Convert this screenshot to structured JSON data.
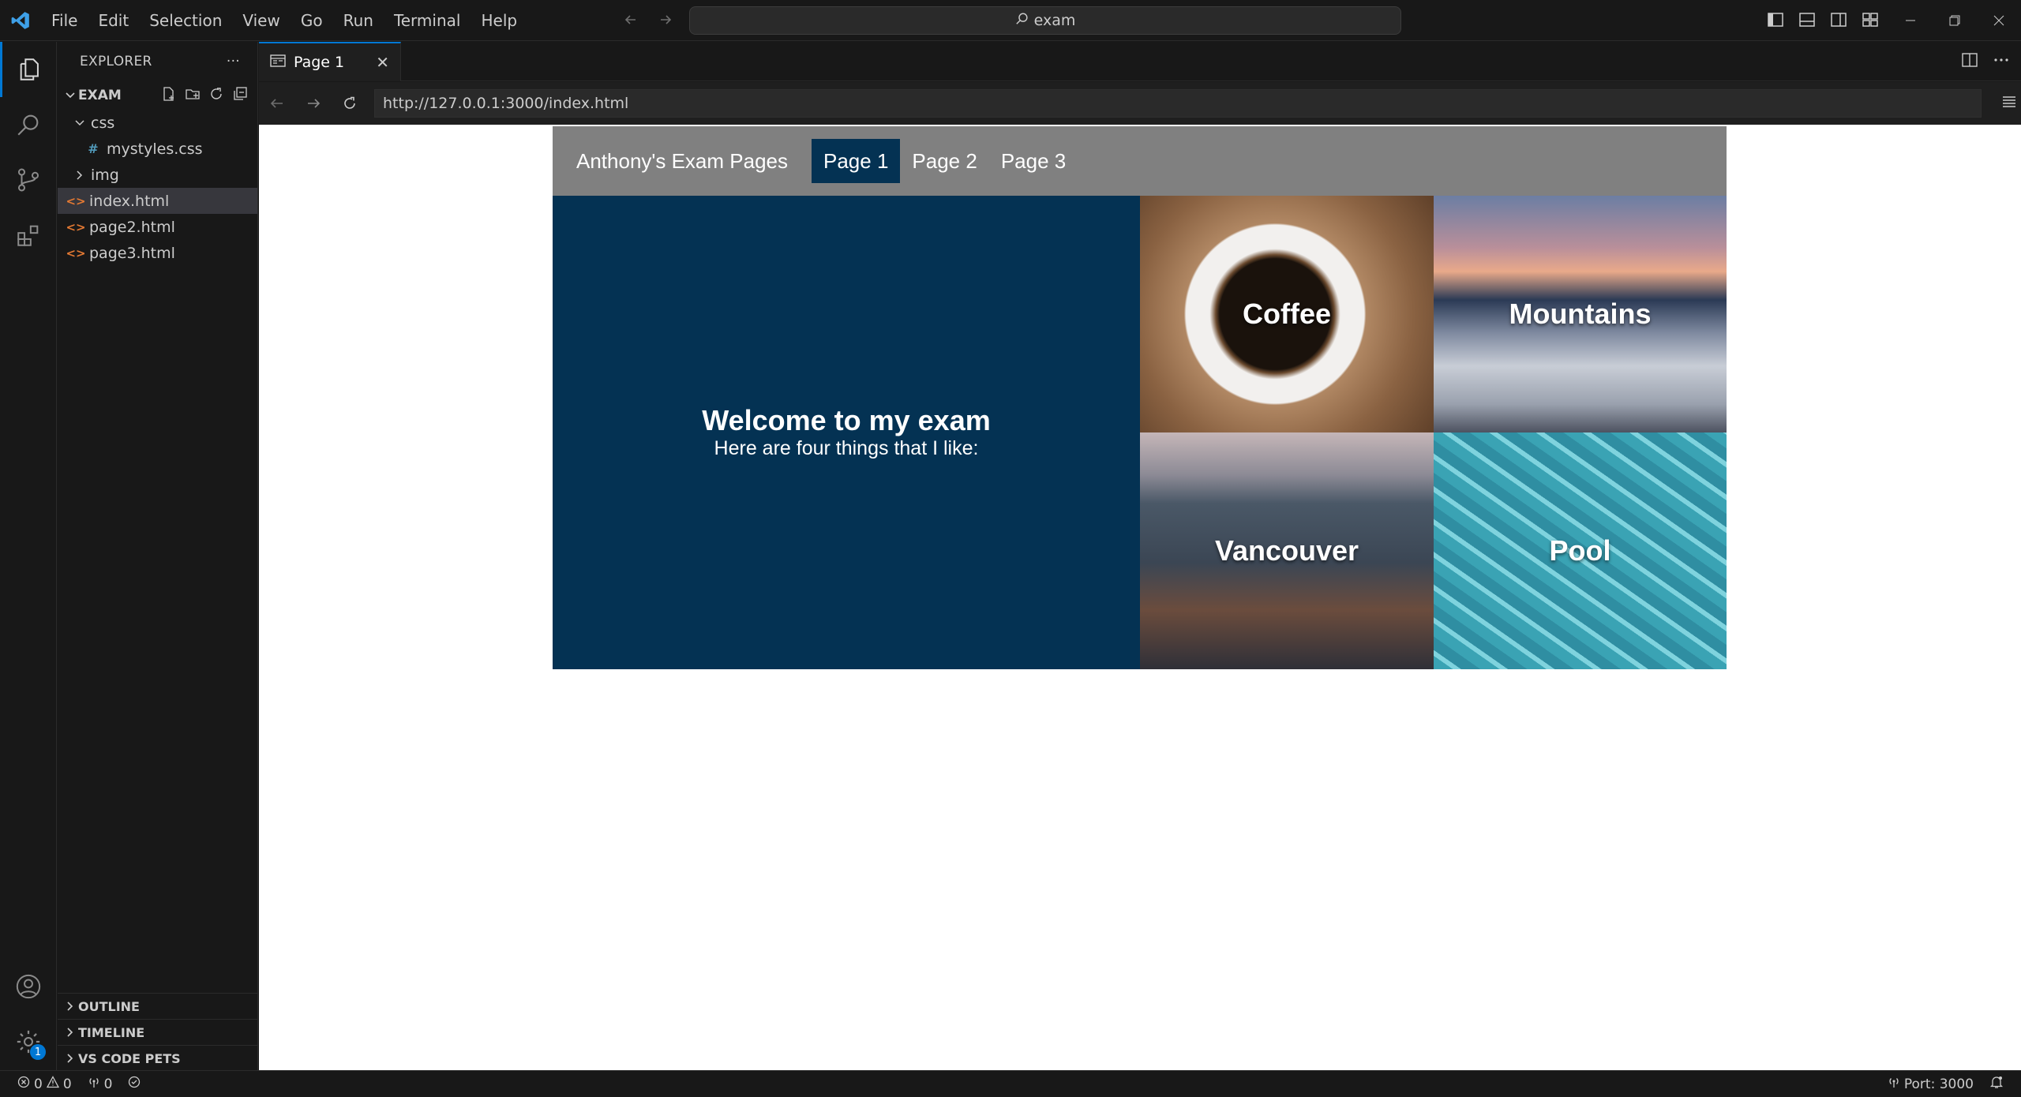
{
  "menu": [
    "File",
    "Edit",
    "Selection",
    "View",
    "Go",
    "Run",
    "Terminal",
    "Help"
  ],
  "search": {
    "text": "exam"
  },
  "sidebar": {
    "title": "EXPLORER",
    "more": "···",
    "root": "EXAM",
    "tree": [
      {
        "label": "css",
        "kind": "folder-open"
      },
      {
        "label": "mystyles.css",
        "kind": "css"
      },
      {
        "label": "img",
        "kind": "folder"
      },
      {
        "label": "index.html",
        "kind": "html"
      },
      {
        "label": "page2.html",
        "kind": "html"
      },
      {
        "label": "page3.html",
        "kind": "html"
      }
    ],
    "bottom": [
      "OUTLINE",
      "TIMELINE",
      "VS CODE PETS"
    ]
  },
  "tab": {
    "label": "Page 1",
    "close": "✕"
  },
  "browser": {
    "url": "http://127.0.0.1:3000/index.html"
  },
  "site": {
    "brand": "Anthony's Exam Pages",
    "nav": [
      "Page 1",
      "Page 2",
      "Page 3"
    ],
    "hero_title": "Welcome to my exam",
    "hero_sub": "Here are four things that I like:",
    "tiles": [
      "Coffee",
      "Mountains",
      "Vancouver",
      "Pool"
    ]
  },
  "status": {
    "errors": "0",
    "warnings": "0",
    "ports": "0",
    "port": "Port: 3000"
  },
  "settings_badge": "1",
  "colors": {
    "accent": "#0078d4",
    "site_nav": "#808080",
    "site_dark": "#043253"
  }
}
